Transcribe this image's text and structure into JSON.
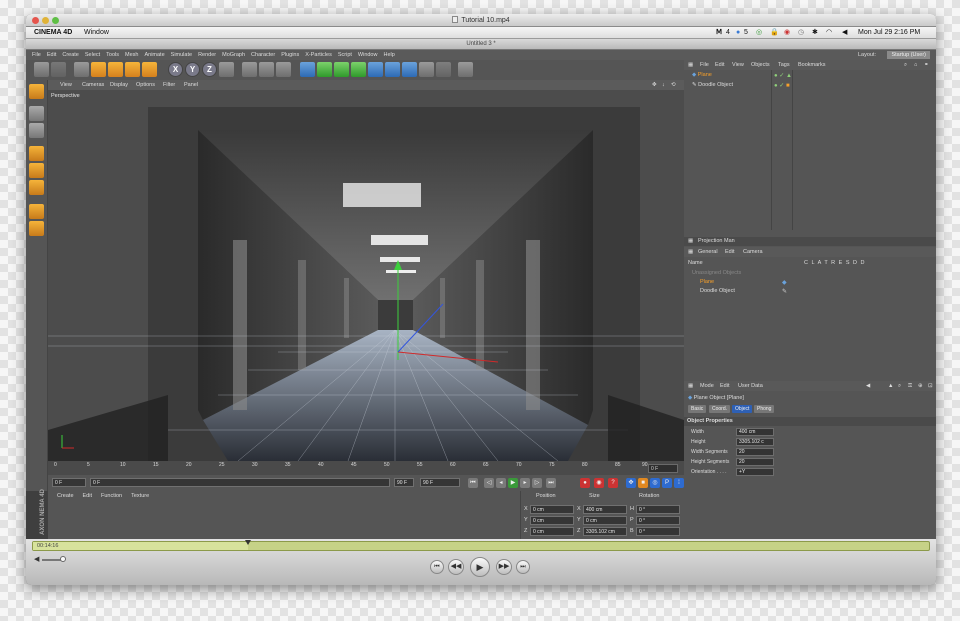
{
  "player": {
    "title": "Tutorial 10.mp4",
    "elapsed": "00:14:16",
    "progress": 0.24
  },
  "os_menubar": {
    "app": "CINEMA 4D",
    "window_menu": "Window",
    "status_num_a": "4",
    "status_num_b": "5",
    "clock": "Mon Jul 29  2:16 PM"
  },
  "c4d": {
    "doc_title": "Untitled 3 *",
    "menus": [
      "File",
      "Edit",
      "Create",
      "Select",
      "Tools",
      "Mesh",
      "Animate",
      "Simulate",
      "Render",
      "MoGraph",
      "Character",
      "Plugins",
      "X-Particles",
      "Script",
      "Window",
      "Help"
    ],
    "layout_label": "Layout:",
    "layout_value": "Startup (User)"
  },
  "viewport": {
    "menus": [
      "View",
      "Cameras",
      "Display",
      "Options",
      "Filter",
      "Panel"
    ],
    "label": "Perspective"
  },
  "timeline": {
    "ticks": [
      "0",
      "5",
      "10",
      "15",
      "20",
      "25",
      "30",
      "35",
      "40",
      "45",
      "50",
      "55",
      "60",
      "65",
      "70",
      "75",
      "80",
      "85",
      "90"
    ],
    "frame_display": "0 F",
    "start_field": "0 F",
    "current_field": "0 F",
    "end_field": "90 F",
    "max_field": "90 F"
  },
  "material": {
    "menus": [
      "Create",
      "Edit",
      "Function",
      "Texture"
    ],
    "logo": "AXON NEMA 4D"
  },
  "coordinates": {
    "headers": [
      "Position",
      "Size",
      "Rotation"
    ],
    "rows": [
      {
        "axis": "X",
        "pos": "0 cm",
        "size_axis": "X",
        "size": "400 cm",
        "rot_axis": "H",
        "rot": "0 °"
      },
      {
        "axis": "Y",
        "pos": "0 cm",
        "size_axis": "Y",
        "size": "0 cm",
        "rot_axis": "P",
        "rot": "0 °"
      },
      {
        "axis": "Z",
        "pos": "0 cm",
        "size_axis": "Z",
        "size": "3305.102 cm",
        "rot_axis": "B",
        "rot": "0 °"
      }
    ]
  },
  "objects_panel": {
    "menus": [
      "File",
      "Edit",
      "View",
      "Objects",
      "Tags",
      "Bookmarks"
    ],
    "objects": [
      "Plane",
      "Doodle Object"
    ]
  },
  "projection_panel": {
    "title": "Projection Man",
    "menus": [
      "General",
      "Edit",
      "Camera"
    ],
    "name_col": "Name",
    "flag_cols": "C L A T R E S D D",
    "group": "Unassigned Objects",
    "items": [
      "Plane",
      "Doodle Object"
    ]
  },
  "attributes_panel": {
    "menus": [
      "Mode",
      "Edit",
      "User Data"
    ],
    "object_title": "Plane Object [Plane]",
    "tabs": [
      "Basic",
      "Coord.",
      "Object",
      "Phong"
    ],
    "active_tab": "Object",
    "section": "Object Properties",
    "props": [
      {
        "label": "Width",
        "value": "400 cm"
      },
      {
        "label": "Height",
        "value": "3305.102 c"
      },
      {
        "label": "Width Segments",
        "value": "20"
      },
      {
        "label": "Height Segments",
        "value": "20"
      },
      {
        "label": "Orientation . . . .",
        "value": "+Y"
      }
    ]
  },
  "colors": {
    "accent_orange": "#f7a02a",
    "selected_blue": "#2e60b5",
    "scrub_green": "#c6d287"
  }
}
